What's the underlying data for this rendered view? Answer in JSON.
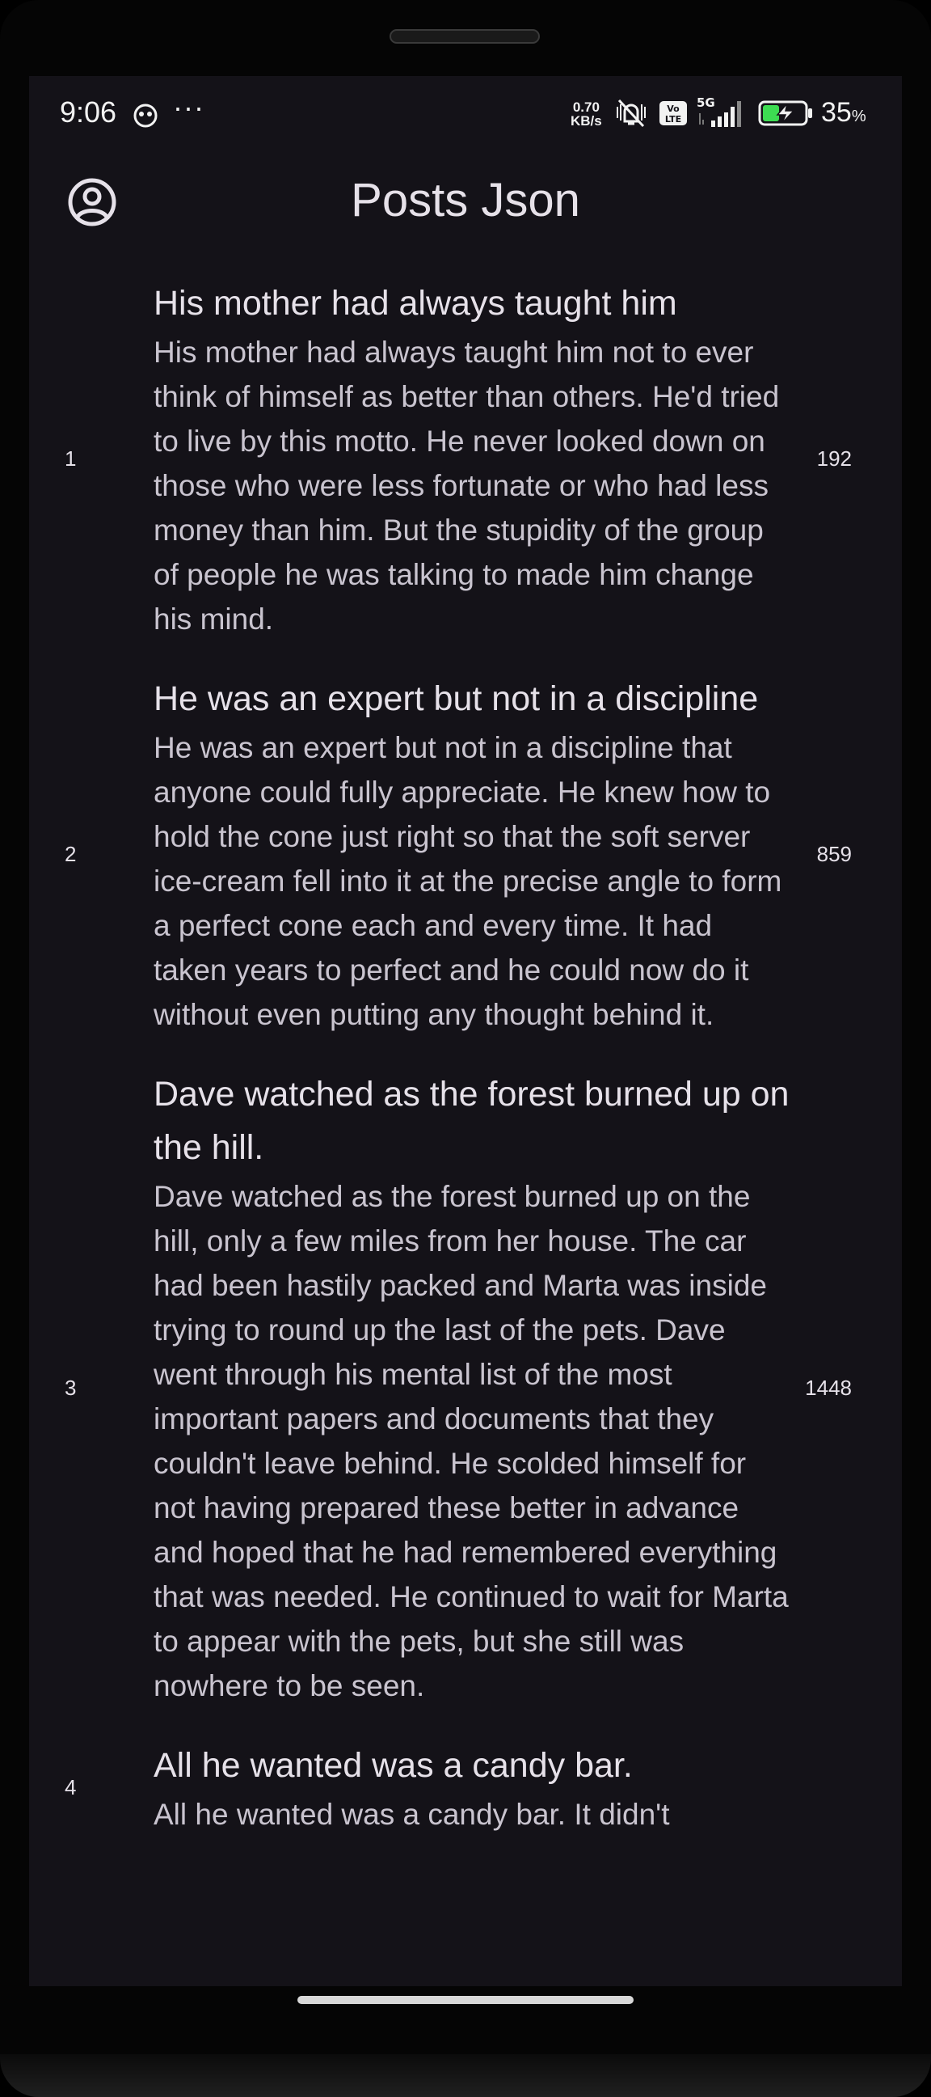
{
  "status_bar": {
    "time": "9:06",
    "more": "···",
    "net_speed_value": "0.70",
    "net_speed_unit": "KB/s",
    "network": "5G",
    "volte": "Vo LTE",
    "battery_percent": "35",
    "battery_unit": "%"
  },
  "app_bar": {
    "title": "Posts Json",
    "account_icon": "account-circle-icon"
  },
  "posts": [
    {
      "id": "1",
      "title": "His mother had always taught him",
      "body": "His mother had always taught him not to ever think of himself as better than others. He'd tried to live by this motto. He never looked down on those who were less fortunate or who had less money than him. But the stupidity of the group of people he was talking to made him change his mind.",
      "views": "192"
    },
    {
      "id": "2",
      "title": "He was an expert but not in a discipline",
      "body": "He was an expert but not in a discipline that anyone could fully appreciate. He knew how to hold the cone just right so that the soft server ice-cream fell into it at the precise angle to form a perfect cone each and every time. It had taken years to perfect and he could now do it without even putting any thought behind it.",
      "views": "859"
    },
    {
      "id": "3",
      "title": "Dave watched as the forest burned up on the hill.",
      "body": "Dave watched as the forest burned up on the hill, only a few miles from her house. The car had been hastily packed and Marta was inside trying to round up the last of the pets. Dave went through his mental list of the most important papers and documents that they couldn't leave behind. He scolded himself for not having prepared these better in advance and hoped that he had remembered everything that was needed. He continued to wait for Marta to appear with the pets, but she still was nowhere to be seen.",
      "views": "1448"
    },
    {
      "id": "4",
      "title": "All he wanted was a candy bar.",
      "body": "All he wanted was a candy bar. It didn't",
      "views": ""
    }
  ]
}
